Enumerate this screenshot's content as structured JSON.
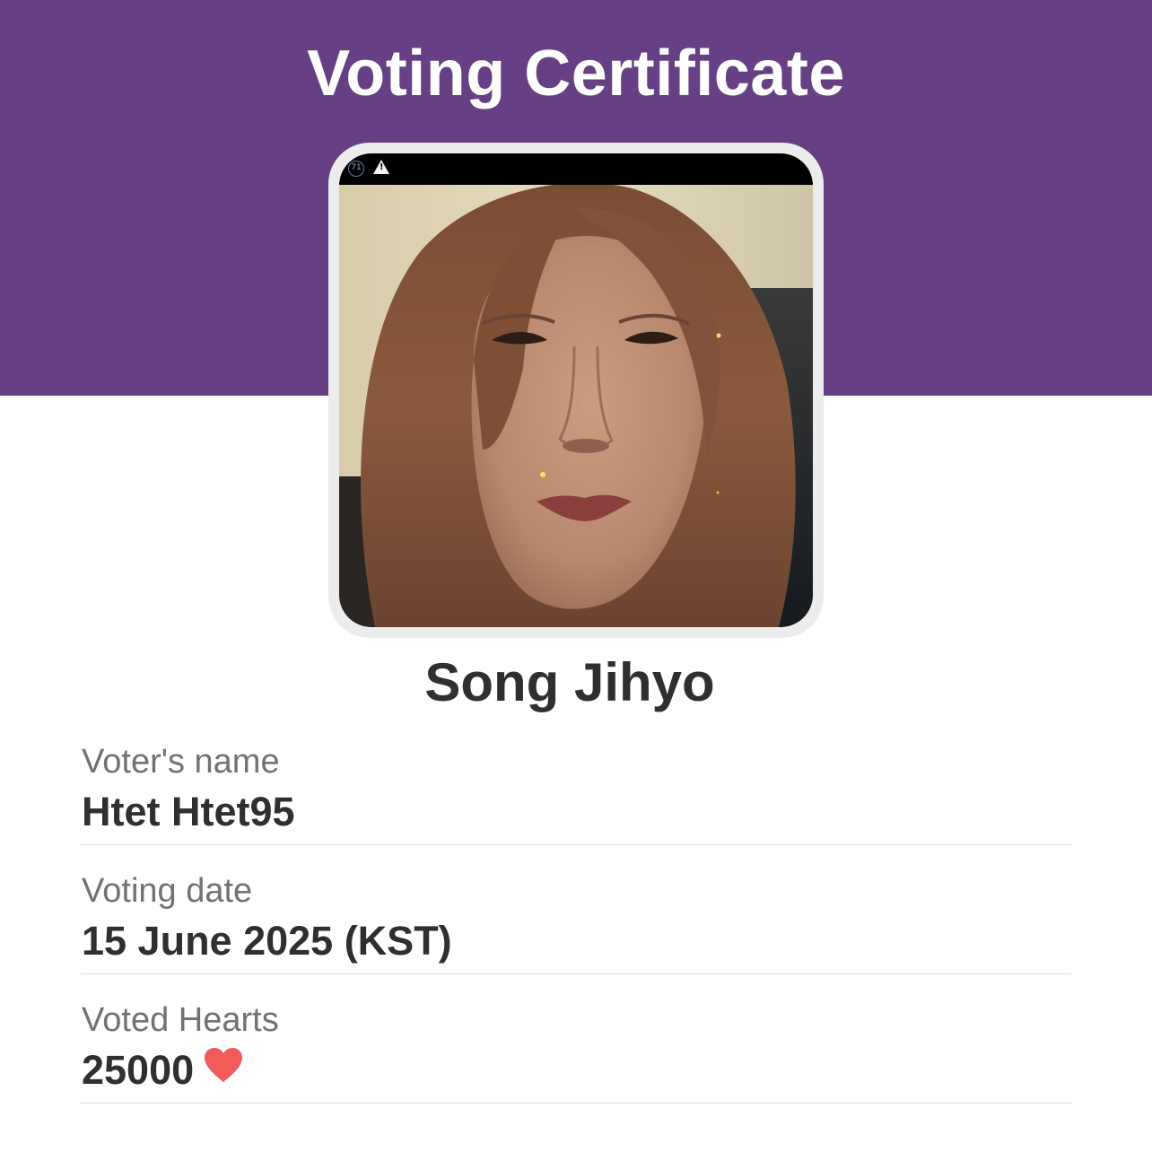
{
  "header": {
    "title": "Voting Certificate",
    "band_color": "#673f85"
  },
  "photo": {
    "icon": "portrait-photo",
    "status_strip": {
      "badge_text": "71",
      "warning_icon": "warning-icon"
    }
  },
  "idol": {
    "name": "Song Jihyo"
  },
  "details": {
    "voter_name": {
      "label": "Voter's name",
      "value": "Htet Htet95"
    },
    "voting_date": {
      "label": "Voting date",
      "value": "15 June 2025 (KST)"
    },
    "voted_hearts": {
      "label": "Voted Hearts",
      "value": "25000",
      "icon": "heart-icon",
      "icon_color": "#f25b5b"
    }
  }
}
